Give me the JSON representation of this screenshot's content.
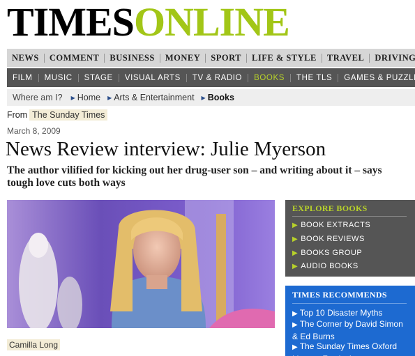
{
  "masthead": {
    "times": "TIMES",
    "online": "ONLINE"
  },
  "nav_primary": [
    "NEWS",
    "COMMENT",
    "BUSINESS",
    "MONEY",
    "SPORT",
    "LIFE & STYLE",
    "TRAVEL",
    "DRIVING"
  ],
  "nav_secondary": [
    "FILM",
    "MUSIC",
    "STAGE",
    "VISUAL ARTS",
    "TV & RADIO",
    "BOOKS",
    "THE TLS",
    "GAMES & PUZZLES"
  ],
  "nav_secondary_active": "BOOKS",
  "breadcrumb": {
    "lead": "Where am I?",
    "items": [
      "Home",
      "Arts & Entertainment",
      "Books"
    ]
  },
  "article": {
    "from_label": "From",
    "source": "The Sunday Times",
    "date": "March 8, 2009",
    "headline": "News Review interview: Julie Myerson",
    "standfirst": "The author vilified for kicking out her drug-user son – and writing about it – says tough love cuts both ways",
    "byline": "Camilla Long"
  },
  "explore": {
    "title": "EXPLORE BOOKS",
    "links": [
      "BOOK EXTRACTS",
      "BOOK REVIEWS",
      "BOOKS GROUP",
      "AUDIO BOOKS"
    ]
  },
  "recommends": {
    "title": "TIMES RECOMMENDS",
    "links": [
      "Top 10 Disaster Myths",
      "The Corner by David Simon & Ed Burns",
      "The Sunday Times Oxford Literary Festival"
    ]
  },
  "colors": {
    "brand_green": "#a2c617",
    "nav_dark": "#555555",
    "nav_light": "#d6d6d6",
    "recommend_blue": "#1d6ad1"
  }
}
